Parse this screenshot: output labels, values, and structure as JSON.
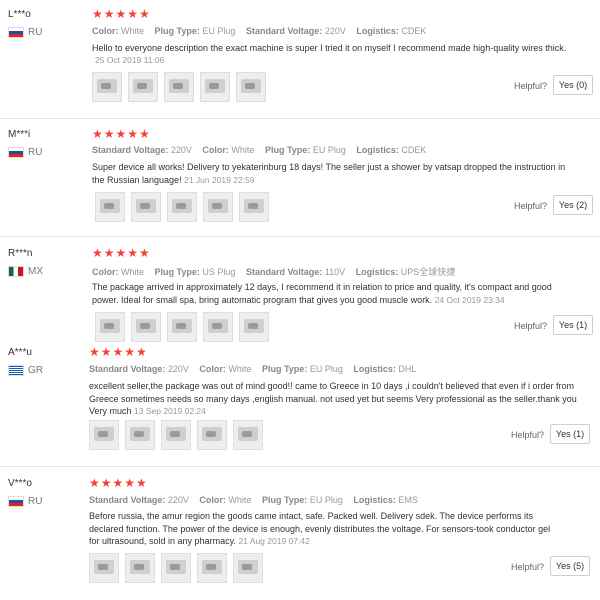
{
  "reviews": [
    {
      "user": "L***o",
      "country": "RU",
      "stars": "★★★★★",
      "attrs": [
        {
          "k": "Color:",
          "v": "White"
        },
        {
          "k": "Plug Type:",
          "v": "EU Plug"
        },
        {
          "k": "Standard Voltage:",
          "v": "220V"
        },
        {
          "k": "Logistics:",
          "v": "CDEK"
        }
      ],
      "text": "Hello to everyone description the exact machine is super I tried it on myself I recommend made high-quality wires thick.",
      "date": "25 Oct 2019 11:06",
      "helpful_label": "Helpful?",
      "yes_label": "Yes (0)"
    },
    {
      "user": "M***i",
      "country": "RU",
      "stars": "★★★★★",
      "attrs": [
        {
          "k": "Standard Voltage:",
          "v": "220V"
        },
        {
          "k": "Color:",
          "v": "White"
        },
        {
          "k": "Plug Type:",
          "v": "EU Plug"
        },
        {
          "k": "Logistics:",
          "v": "CDEK"
        }
      ],
      "text": "Super device all works! Delivery to yekaterinburg 18 days! The seller just a shower by vatsap dropped the instruction in the Russian language!",
      "date": "21 Jun 2019 22:59",
      "helpful_label": "Helpful?",
      "yes_label": "Yes (2)"
    },
    {
      "user": "R***n",
      "country": "MX",
      "stars": "★★★★★",
      "attrs": [
        {
          "k": "Color:",
          "v": "White"
        },
        {
          "k": "Plug Type:",
          "v": "US Plug"
        },
        {
          "k": "Standard Voltage:",
          "v": "110V"
        },
        {
          "k": "Logistics:",
          "v": "UPS全球快捷"
        }
      ],
      "text": "The package arrived in approximately 12 days, I recommend it in relation to price and quality, it's compact and good power. Ideal for small spa, bring automatic program that gives you good muscle work.",
      "date": "24 Oct 2019 23:34",
      "helpful_label": "Helpful?",
      "yes_label": "Yes (1)"
    },
    {
      "user": "A***u",
      "country": "GR",
      "stars": "★★★★★",
      "attrs": [
        {
          "k": "Standard Voltage:",
          "v": "220V"
        },
        {
          "k": "Color:",
          "v": "White"
        },
        {
          "k": "Plug Type:",
          "v": "EU Plug"
        },
        {
          "k": "Logistics:",
          "v": "DHL"
        }
      ],
      "text": "excellent seller,the package was out of mind good!! came to Greece in 10 days ,i couldn't believed that even if i order from Greece sometimes needs so many days ,english manual. not used yet but seems Very professional as the seller.thank you Very much",
      "date": "13 Sep 2019 02:24",
      "helpful_label": "Helpful?",
      "yes_label": "Yes (1)"
    },
    {
      "user": "V***o",
      "country": "RU",
      "stars": "★★★★★",
      "attrs": [
        {
          "k": "Standard Voltage:",
          "v": "220V"
        },
        {
          "k": "Color:",
          "v": "White"
        },
        {
          "k": "Plug Type:",
          "v": "EU Plug"
        },
        {
          "k": "Logistics:",
          "v": "EMS"
        }
      ],
      "text": "Before russia, the amur region the goods came intact, safe. Packed well. Delivery sdek. The device performs its declared function. The power of the device is enough, evenly distributes the voltage. For sensors-took conductor gel for ultrasound, sold in any pharmacy.",
      "date": "21 Aug 2019 07:42",
      "helpful_label": "Helpful?",
      "yes_label": "Yes (5)"
    }
  ]
}
